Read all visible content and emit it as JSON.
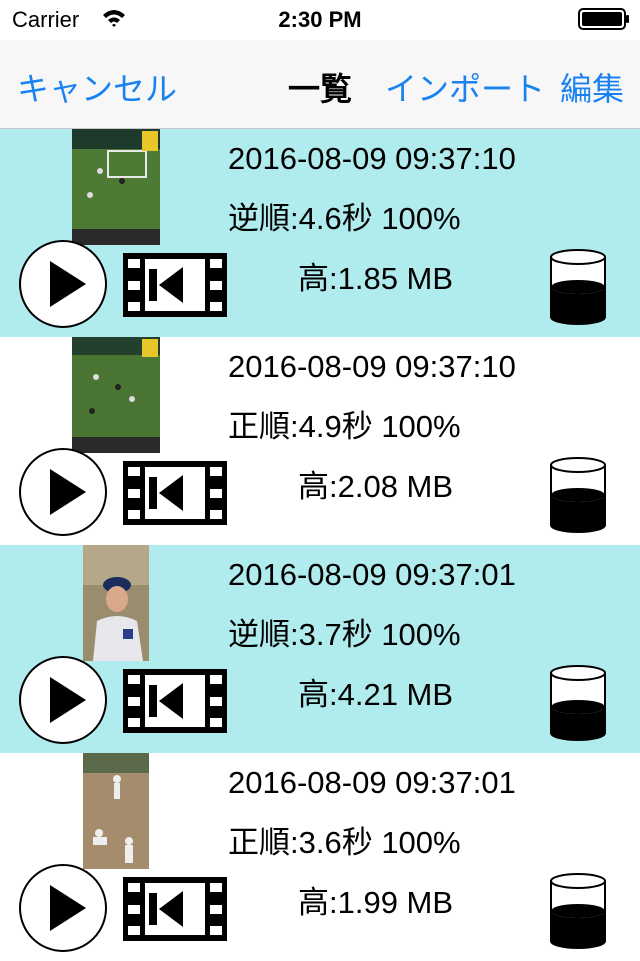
{
  "status_bar": {
    "carrier": "Carrier",
    "time": "2:30 PM"
  },
  "nav": {
    "cancel_label": "キャンセル",
    "title": "一覧",
    "import_label": "インポート",
    "edit_label": "編集"
  },
  "colors": {
    "highlight": "#b0ecee",
    "accent": "#1a82f0"
  },
  "videos": [
    {
      "timestamp": "2016-08-09 09:37:10",
      "detail": "逆順:4.6秒 100%",
      "quality_size": "高:1.85 MB",
      "highlighted": true,
      "storage_level": 0.55
    },
    {
      "timestamp": "2016-08-09 09:37:10",
      "detail": "正順:4.9秒 100%",
      "quality_size": "高:2.08 MB",
      "highlighted": false,
      "storage_level": 0.55
    },
    {
      "timestamp": "2016-08-09 09:37:01",
      "detail": "逆順:3.7秒 100%",
      "quality_size": "高:4.21 MB",
      "highlighted": true,
      "storage_level": 0.5
    },
    {
      "timestamp": "2016-08-09 09:37:01",
      "detail": "正順:3.6秒 100%",
      "quality_size": "高:1.99 MB",
      "highlighted": false,
      "storage_level": 0.55
    }
  ]
}
